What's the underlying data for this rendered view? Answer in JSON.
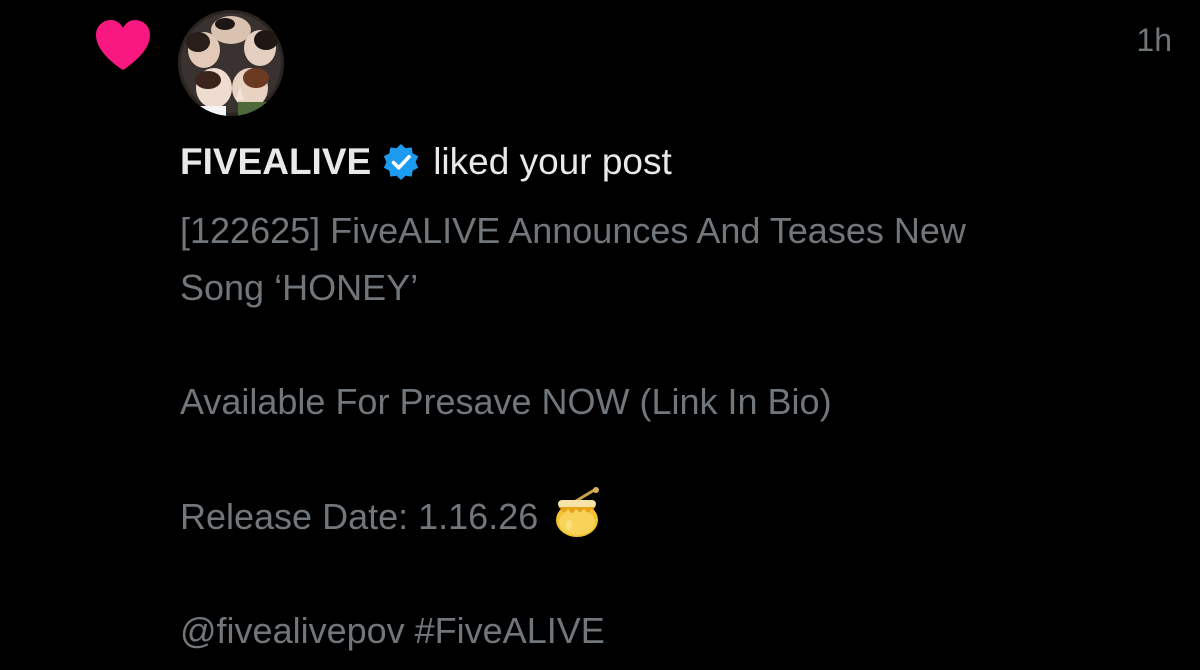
{
  "notification": {
    "type": "like",
    "timestamp": "1h",
    "author": {
      "name": "FIVEALIVE",
      "verified": true,
      "avatar_icon": "group-photo-avatar"
    },
    "action_text": "liked your post",
    "heart_color": "#f91880",
    "verified_color": "#1d9bf0",
    "post": {
      "line1": "[122625] FiveALIVE Announces And Teases New",
      "line2": "Song ‘HONEY’",
      "line3": "Available For Presave NOW (Link In Bio)",
      "line4": "Release Date: 1.16.26",
      "line4_emoji": "honey-pot-icon",
      "line5": "@fivealivepov #FiveALIVE"
    }
  }
}
